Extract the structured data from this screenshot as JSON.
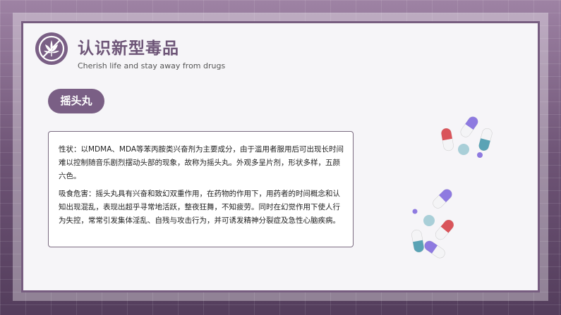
{
  "header": {
    "title": "认识新型毒品",
    "subtitle": "Cherish life and stay away from drugs"
  },
  "tag": {
    "label": "摇头丸"
  },
  "content": {
    "paragraph1": "性状：以MDMA、MDA等苯丙胺类兴奋剂为主要成分，由于滥用者服用后可出现长时间难以控制随音乐剧烈摆动头部的现象，故称为摇头丸。外观多呈片剂，形状多样，五颜六色。",
    "paragraph2": "吸食危害：摇头丸具有兴奋和致幻双重作用，在药物的作用下，用药者的时间概念和认知出现混乱，表现出超乎寻常地活跃，整夜狂舞，不知疲劳。同时在幻觉作用下使人行为失控，常常引发集体淫乱、自残与攻击行为，并可诱发精神分裂症及急性心脑疾病。"
  },
  "icons": {
    "logo": "cannabis-leaf-icon",
    "illustration": "pills-capsules-icon"
  },
  "colors": {
    "accent": "#7a5f85",
    "frame": "#775d80",
    "capsule_red": "#d9545a",
    "capsule_teal": "#5aa3b5",
    "capsule_purple": "#8e7ae0"
  }
}
